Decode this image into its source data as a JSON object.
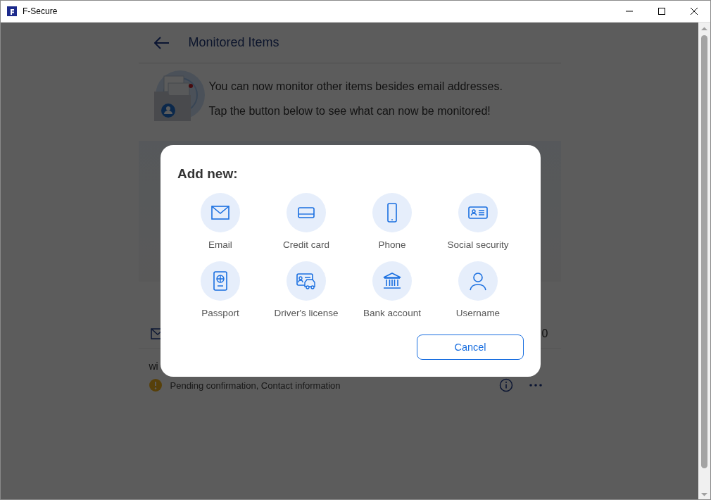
{
  "window": {
    "title": "F-Secure"
  },
  "page": {
    "title": "Monitored Items",
    "notice": [
      "You can now monitor other items besides email addresses.",
      "Tap the button below to see what can now be monitored!"
    ]
  },
  "monitored_item": {
    "count_fragment": "0",
    "value_fragment": "wi",
    "status": "Pending confirmation, Contact information"
  },
  "dialog": {
    "title": "Add new:",
    "options": [
      {
        "label": "Email"
      },
      {
        "label": "Credit card"
      },
      {
        "label": "Phone"
      },
      {
        "label": "Social security"
      },
      {
        "label": "Passport"
      },
      {
        "label": "Driver's license"
      },
      {
        "label": "Bank account"
      },
      {
        "label": "Username"
      }
    ],
    "buttons": [
      "Cancel"
    ]
  }
}
